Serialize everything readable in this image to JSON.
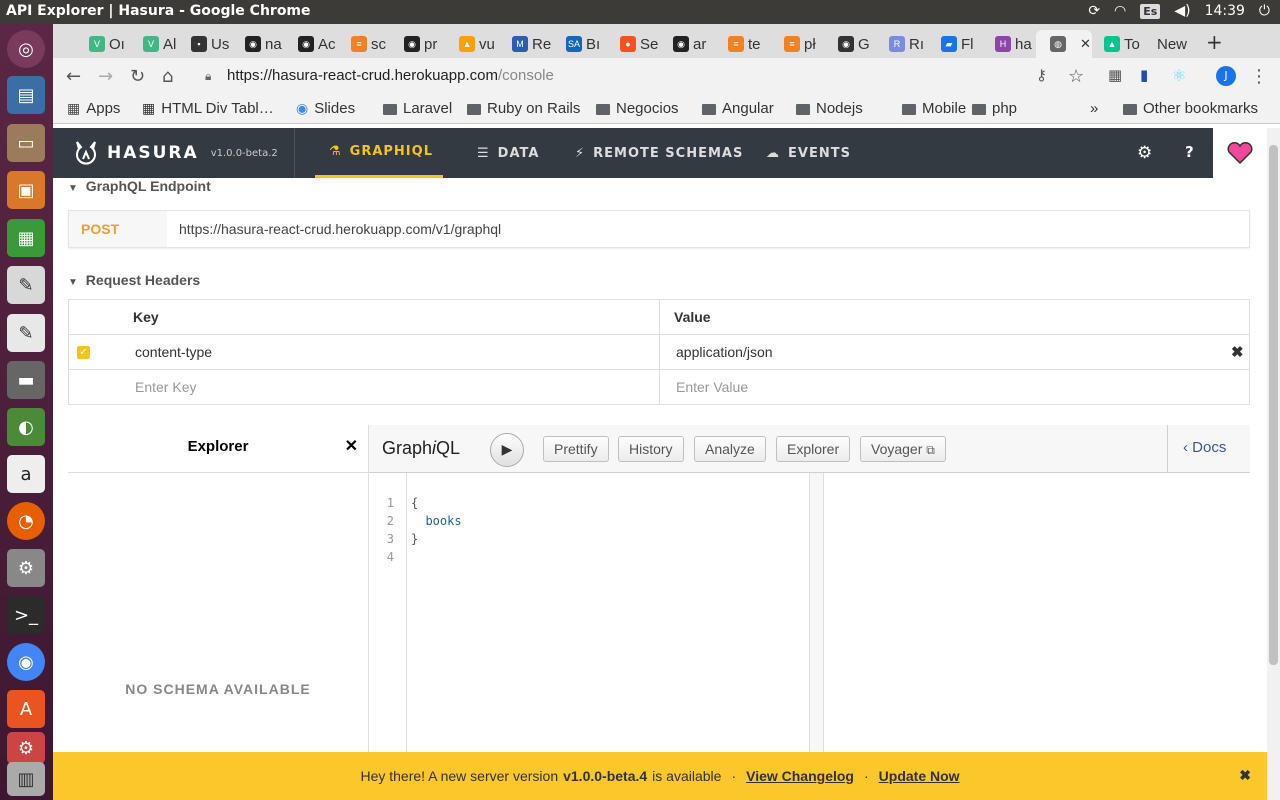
{
  "os": {
    "window_title": "API Explorer | Hasura - Google Chrome",
    "keyboard_layout": "Es",
    "clock": "14:39"
  },
  "launcher": {
    "icons": [
      "ubuntu-icon",
      "files-doc-icon",
      "files-icon",
      "impress-icon",
      "calc-icon",
      "writer-icon",
      "texteditor-icon",
      "screen-icon",
      "image-viewer-icon",
      "amazon-icon",
      "firefox-icon",
      "settings-icon",
      "terminal-icon",
      "chrome-icon",
      "software-center-icon",
      "stack-icon",
      "trash-icon"
    ]
  },
  "tabs": [
    {
      "label": "Oı",
      "color": "#41b883",
      "glyph": "V"
    },
    {
      "label": "Al",
      "color": "#41b883",
      "glyph": "V"
    },
    {
      "label": "Us",
      "color": "#333333",
      "glyph": "▪"
    },
    {
      "label": "na",
      "color": "#222222",
      "glyph": "◉"
    },
    {
      "label": "Ac",
      "color": "#222222",
      "glyph": "◉"
    },
    {
      "label": "sc",
      "color": "#f48024",
      "glyph": "≡"
    },
    {
      "label": "pr",
      "color": "#222222",
      "glyph": "◉"
    },
    {
      "label": "vu",
      "color": "#ffa000",
      "glyph": "▲"
    },
    {
      "label": "Re",
      "color": "#2a5db0",
      "glyph": "M"
    },
    {
      "label": "Bı",
      "color": "#1565c0",
      "glyph": "SA"
    },
    {
      "label": "Se",
      "color": "#f4511e",
      "glyph": "●"
    },
    {
      "label": "ar",
      "color": "#222222",
      "glyph": "◉"
    },
    {
      "label": "te",
      "color": "#f48024",
      "glyph": "≡"
    },
    {
      "label": "pł",
      "color": "#f48024",
      "glyph": "≡"
    },
    {
      "label": "G",
      "color": "#333333",
      "glyph": "◉"
    },
    {
      "label": "Rı",
      "color": "#7b8cde",
      "glyph": "R"
    },
    {
      "label": "Fl",
      "color": "#1a73e8",
      "glyph": "▰"
    },
    {
      "label": "ha",
      "color": "#8e44ad",
      "glyph": "H"
    },
    {
      "label": "",
      "color": "#666666",
      "glyph": "◍"
    },
    {
      "label": "To",
      "color": "#00c58e",
      "glyph": "▲"
    },
    {
      "label": "New",
      "color": "",
      "glyph": ""
    }
  ],
  "toolbar": {
    "url_host": "https://hasura-react-crud.herokuapp.com",
    "url_path": "/console",
    "avatar_letter": "J"
  },
  "bookmarks": {
    "apps": "Apps",
    "items": [
      "HTML Div Tabl…",
      "Slides",
      "Laravel",
      "Ruby on Rails",
      "Negocios",
      "Angular",
      "Nodejs",
      "Mobile",
      "php"
    ],
    "overflow": "»",
    "other": "Other bookmarks"
  },
  "hasura": {
    "brand": "HASURA",
    "version": "v1.0.0-beta.2",
    "nav": [
      {
        "label": "GRAPHIQL",
        "icon": "flask-icon",
        "active": true
      },
      {
        "label": "DATA",
        "icon": "database-icon",
        "active": false
      },
      {
        "label": "REMOTE SCHEMAS",
        "icon": "plug-icon",
        "active": false
      },
      {
        "label": "EVENTS",
        "icon": "cloud-icon",
        "active": false
      }
    ]
  },
  "endpoint": {
    "section_title": "GraphQL Endpoint",
    "method": "POST",
    "url": "https://hasura-react-crud.herokuapp.com/v1/graphql"
  },
  "request_headers": {
    "section_title": "Request Headers",
    "col_key": "Key",
    "col_value": "Value",
    "rows": [
      {
        "key": "content-type",
        "value": "application/json",
        "checked": true
      }
    ],
    "key_placeholder": "Enter Key",
    "value_placeholder": "Enter Value"
  },
  "explorer": {
    "title": "Explorer",
    "empty": "NO SCHEMA AVAILABLE"
  },
  "graphiql": {
    "title_plain": "Graph",
    "title_italic": "i",
    "title_end": "QL",
    "buttons": [
      "Prettify",
      "History",
      "Analyze",
      "Explorer",
      "Voyager"
    ],
    "docs": "Docs",
    "line_numbers": [
      "1",
      "2",
      "3",
      "4"
    ],
    "code_lines": [
      "{",
      "  books",
      "}",
      ""
    ]
  },
  "notification": {
    "prefix": "Hey there! A new server version",
    "version": "v1.0.0-beta.4",
    "suffix": "is available",
    "sep": "·",
    "changelog": "View Changelog",
    "update": "Update Now"
  }
}
